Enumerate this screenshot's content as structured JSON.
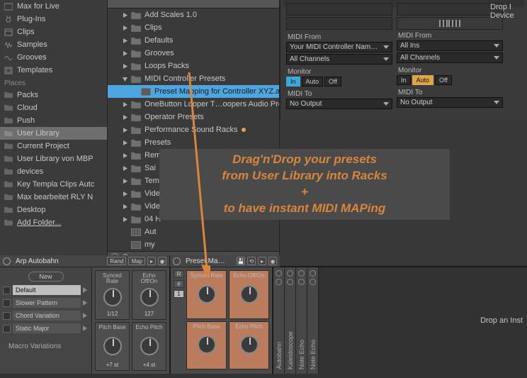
{
  "places": {
    "items": [
      {
        "icon": "maxforlive",
        "label": "Max for Live"
      },
      {
        "icon": "plugins",
        "label": "Plug-Ins"
      },
      {
        "icon": "clips",
        "label": "Clips"
      },
      {
        "icon": "samples",
        "label": "Samples"
      },
      {
        "icon": "grooves",
        "label": "Grooves"
      },
      {
        "icon": "templates",
        "label": "Templates"
      }
    ],
    "header": "Places",
    "places_items": [
      {
        "label": "Packs"
      },
      {
        "label": "Cloud"
      },
      {
        "label": "Push"
      },
      {
        "label": "User Library",
        "selected": true
      },
      {
        "label": "Current Project"
      },
      {
        "label": "User Library von MBP"
      },
      {
        "label": "devices"
      },
      {
        "label": "Key Templa Clips Autc"
      },
      {
        "label": "Max bearbeitet RLY N"
      },
      {
        "label": "Desktop"
      },
      {
        "label": "Add Folder...",
        "underline": true
      }
    ]
  },
  "tree": [
    {
      "exp": false,
      "label": "Add Scales 1.0",
      "ind": 1
    },
    {
      "exp": false,
      "label": "Clips",
      "ind": 1
    },
    {
      "exp": false,
      "label": "Defaults",
      "ind": 1
    },
    {
      "exp": false,
      "label": "Grooves",
      "ind": 1
    },
    {
      "exp": false,
      "label": "Loops Packs",
      "ind": 1
    },
    {
      "exp": true,
      "label": "MIDI Controller Presets",
      "ind": 1
    },
    {
      "exp": null,
      "label": "Preset Mapping for Controller XYZ.adv",
      "ind": 2,
      "rack": true,
      "sel": true
    },
    {
      "exp": false,
      "label": "OneButton Looper T…oopers Audio Project",
      "ind": 1
    },
    {
      "exp": false,
      "label": "Operator Presets",
      "ind": 1
    },
    {
      "exp": false,
      "label": "Performance Sound Racks",
      "ind": 1,
      "dot": true
    },
    {
      "exp": false,
      "label": "Presets",
      "ind": 1
    },
    {
      "exp": false,
      "label": "Remote Scripts",
      "ind": 1
    },
    {
      "exp": false,
      "label": "Sai",
      "ind": 1
    },
    {
      "exp": false,
      "label": "Tem",
      "ind": 1
    },
    {
      "exp": false,
      "label": "Vide",
      "ind": 1
    },
    {
      "exp": false,
      "label": "Vide",
      "ind": 1
    },
    {
      "exp": false,
      "label": "04 H",
      "ind": 1
    },
    {
      "exp": null,
      "label": "Aut",
      "ind": 1,
      "rack": true
    },
    {
      "exp": null,
      "label": "my",
      "ind": 1,
      "rack": true
    }
  ],
  "tracks": {
    "a": {
      "midi_from_label": "MIDI From",
      "from_dev": "Your MIDI Controller Name Here! (B",
      "from_ch": "All Channels",
      "monitor_label": "Monitor",
      "mon": [
        "In",
        "Auto",
        "Off"
      ],
      "mon_active": "In",
      "midi_to_label": "MIDI To",
      "to": "No Output"
    },
    "b": {
      "midi_from_label": "MIDI From",
      "from_dev": "All Ins",
      "from_ch": "All Channels",
      "monitor_label": "Monitor",
      "mon": [
        "In",
        "Auto",
        "Off"
      ],
      "mon_active": "Auto",
      "midi_to_label": "MIDI To",
      "to": "No Output"
    },
    "rightcol": {
      "l1": "Drop I",
      "l2": "Device"
    }
  },
  "callout": {
    "l1": "Drag'n'Drop your presets",
    "l2": "from User Library into Racks",
    "l3": "+",
    "l4": "to have instant MIDI MAPing"
  },
  "rack1": {
    "title": "Arp Autobahn",
    "rand": "Rand",
    "map": "Map",
    "new_btn": "New",
    "chains": [
      {
        "label": "Default",
        "default": true
      },
      {
        "label": "Slower Pattern"
      },
      {
        "label": "Chord Variation"
      },
      {
        "label": "Static Major"
      }
    ],
    "macro_label": "Macro Variations",
    "macros": [
      {
        "label": "Synced Rate",
        "val": "1/12"
      },
      {
        "label": "Echo Off/On",
        "val": "127"
      },
      {
        "label": "Pitch Base",
        "val": "+7 st"
      },
      {
        "label": "Echo Pitch",
        "val": "+4 st"
      }
    ]
  },
  "rack2": {
    "title": "Preset Ma…",
    "side": [
      "R",
      "#",
      "1"
    ],
    "macros": [
      {
        "label": "Synced Rate"
      },
      {
        "label": "Echo Off/On"
      },
      {
        "label": "Pitch Base"
      },
      {
        "label": "Echo Pitch"
      }
    ]
  },
  "strips": [
    "Autobahn",
    "Kaleidoscope",
    "Note Echo",
    "Note Echo"
  ],
  "drop_hint": "Drop an Inst"
}
